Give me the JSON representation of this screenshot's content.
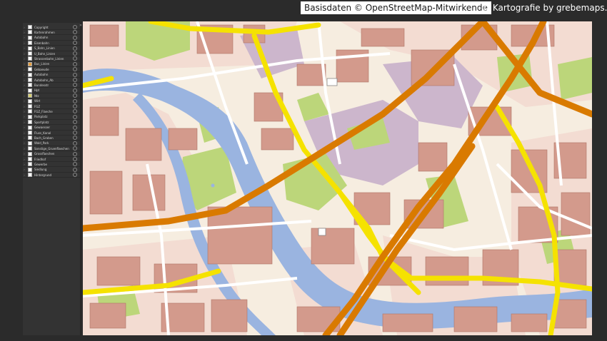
{
  "credits": {
    "osm": "Basisdaten © OpenStreetMap-Mitwirkende",
    "grebe": "© Kartografie by grebemaps.de"
  },
  "layers": [
    {
      "label": "Copyright",
      "color": "#ffffff"
    },
    {
      "label": "Kartenrahmen",
      "color": "#ffffff"
    },
    {
      "label": "Autobahn",
      "color": "#ffffff"
    },
    {
      "label": "Eisenbahn",
      "color": "#ffffff"
    },
    {
      "label": "S_Bahn_Linien",
      "color": "#ffffff"
    },
    {
      "label": "U_Bahn_Linien",
      "color": "#ffffff"
    },
    {
      "label": "Strassenbahn_Linien",
      "color": "#ffffff"
    },
    {
      "label": "Bus_Linien",
      "color": "#e8a040"
    },
    {
      "label": "Gebaeude",
      "color": "#ffffff"
    },
    {
      "label": "Autobahn",
      "color": "#ffffff"
    },
    {
      "label": "Autobahn_Ab",
      "color": "#ffffff"
    },
    {
      "label": "Bundesstr",
      "color": "#ffffff"
    },
    {
      "label": "Hpt",
      "color": "#ffffff"
    },
    {
      "label": "Ntz",
      "color": "#d8d070"
    },
    {
      "label": "Wirt",
      "color": "#ffffff"
    },
    {
      "label": "FGZ",
      "color": "#ffffff"
    },
    {
      "label": "FGZ_Flaeche",
      "color": "#ffffff"
    },
    {
      "label": "Parkplatz",
      "color": "#ffffff"
    },
    {
      "label": "Sportplatz",
      "color": "#ffffff"
    },
    {
      "label": "Gewaesser",
      "color": "#ffffff"
    },
    {
      "label": "Fluss_Kanal",
      "color": "#ffffff"
    },
    {
      "label": "Bach_Graben",
      "color": "#ffffff"
    },
    {
      "label": "Wald_Park",
      "color": "#ffffff"
    },
    {
      "label": "Sonstige_Gruenflaechen",
      "color": "#ffffff"
    },
    {
      "label": "Grossflaechen",
      "color": "#ffffff"
    },
    {
      "label": "Friedhof",
      "color": "#ffffff"
    },
    {
      "label": "Gewerbe",
      "color": "#ffffff"
    },
    {
      "label": "Siedlung",
      "color": "#ffffff"
    },
    {
      "label": "Hintergrund",
      "color": "#ffffff"
    }
  ],
  "map_colors": {
    "land": "#f6ede0",
    "residential": "#f3dcd2",
    "building": "#d39a8c",
    "building_stroke": "#b07666",
    "water": "#9ab4e0",
    "park": "#bcd67a",
    "plaza": "#ccb6cc",
    "primary": "#f5e200",
    "motorway": "#d97a00",
    "street": "#ffffff"
  }
}
